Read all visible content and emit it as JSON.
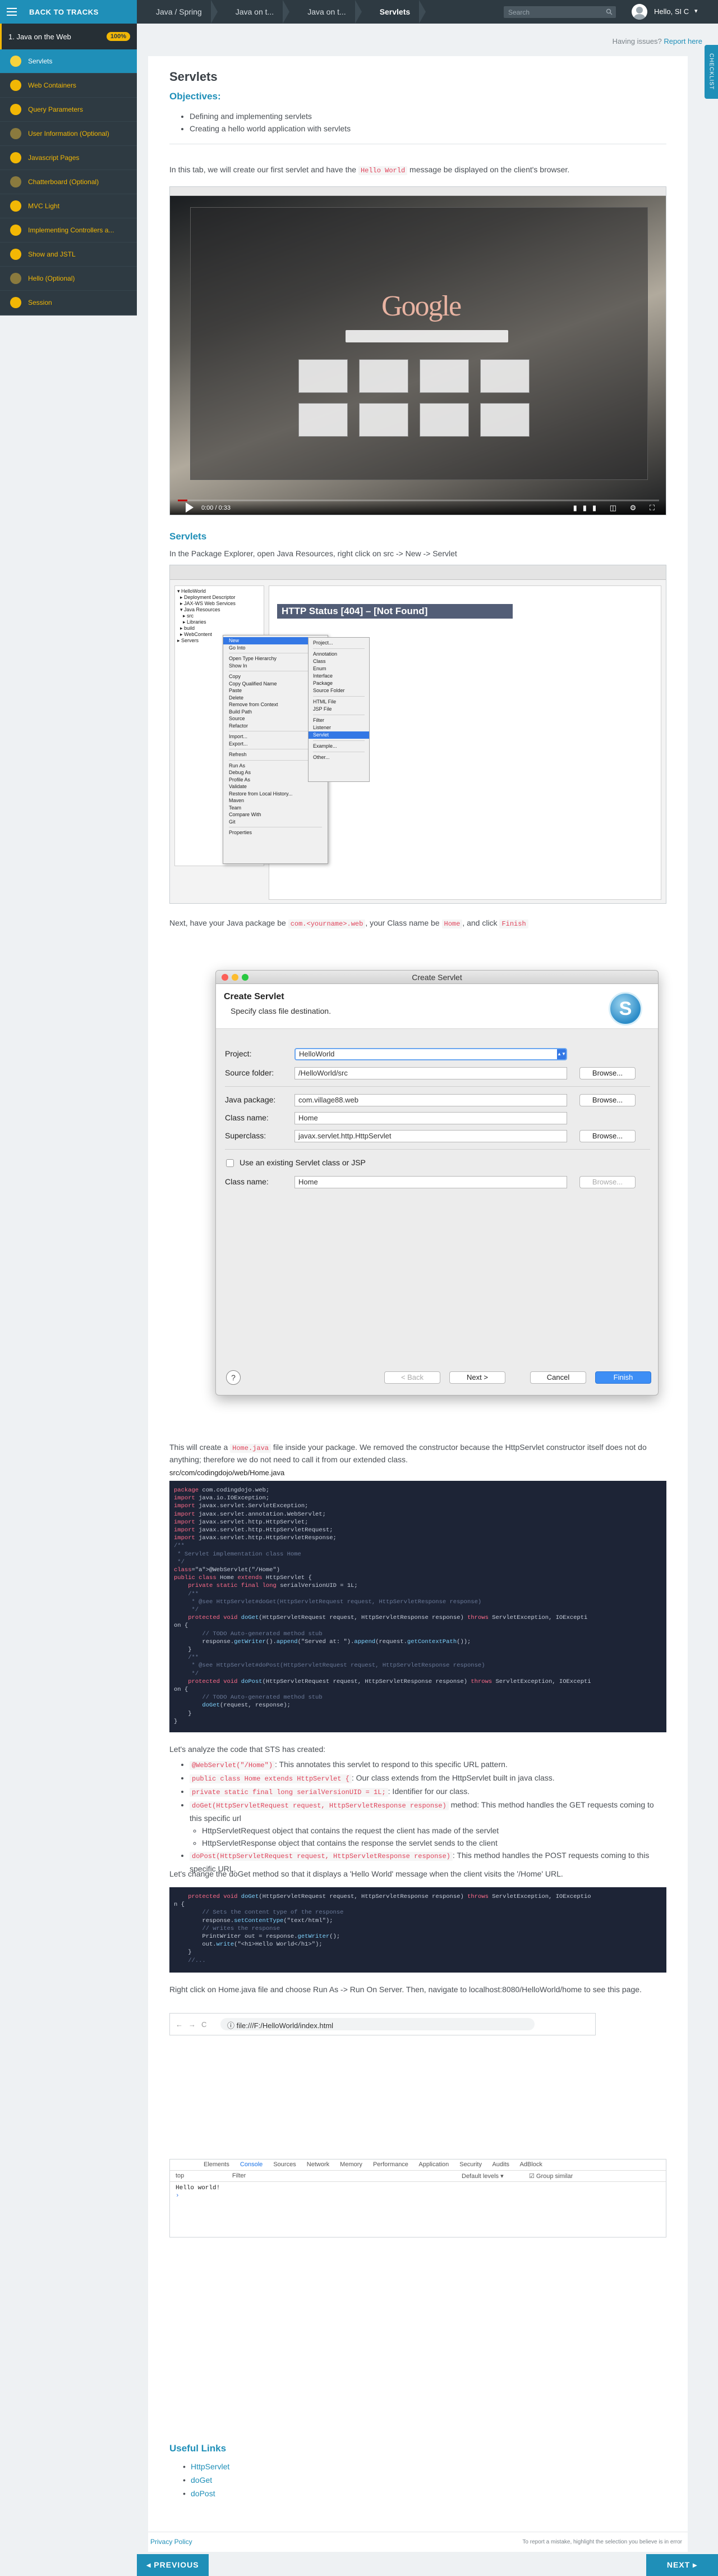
{
  "topbar": {
    "back_label": "BACK TO TRACKS",
    "breadcrumbs": [
      "Java / Spring",
      "Java on t...",
      "Java on t...",
      "Servlets"
    ],
    "search_placeholder": "Search",
    "user_name": "Hello, SI C",
    "user_caret": "▾"
  },
  "sidebar": {
    "header": "1. Java on the Web",
    "progress": "100%",
    "items": [
      {
        "label": "Servlets",
        "active": true
      },
      {
        "label": "Web Containers"
      },
      {
        "label": "Query Parameters"
      },
      {
        "label": "User Information (Optional)"
      },
      {
        "label": "Javascript Pages"
      },
      {
        "label": "Chatterboard (Optional)"
      },
      {
        "label": "MVC Light"
      },
      {
        "label": "Implementing Controllers a..."
      },
      {
        "label": "Show and JSTL"
      },
      {
        "label": "Hello (Optional)"
      },
      {
        "label": "Session"
      }
    ]
  },
  "help": {
    "text": "Having issues?",
    "link": "Report here"
  },
  "side_tab": "CHECKLIST",
  "article": {
    "title": "Servlets",
    "objectives_heading": "Objectives:",
    "objectives": [
      "Defining and implementing servlets",
      "Creating a hello world application with servlets"
    ],
    "intro_before": "In this tab, we will create our first servlet and have the",
    "intro_code": "Hello World",
    "intro_after": "message be displayed on the client's browser.",
    "section_servlets": "Servlets",
    "package_explorer": "In the Package Explorer, open Java Resources, right click on src -> New -> Servlet",
    "next_before": "Next, have your Java package be",
    "next_code1": "com.<yourname>.web",
    "next_mid": ", your Class name be",
    "next_code2": "Home",
    "next_and": ", and click",
    "next_code3": "Finish",
    "create_before": "This will create a",
    "create_code": "Home.java",
    "create_after": "file inside your package. We removed the constructor because the HttpServlet constructor itself does not do anything; therefore we do not need to call it from our extended class.",
    "file_path": "src/com/codingdojo/web/Home.java",
    "analyze": "Let's analyze the code that STS has created:",
    "analysis": [
      {
        "code": "@WebServlet(\"/Home\")",
        "text": ": This annotates this servlet to respond to this specific URL pattern."
      },
      {
        "code": "public class Home extends HttpServlet {",
        "text": ": Our class extends from the HttpServlet built in java class."
      },
      {
        "code": "private static final long serialVersionUID = 1L;",
        "text": ": Identifier for our class."
      },
      {
        "code": "doGet(HttpServletRequest request, HttpServletResponse response)",
        "text": " method: This method handles the GET requests coming to this specific url"
      },
      {
        "code": "doPost(HttpServletRequest request, HttpServletResponse response)",
        "text": ": This method handles the POST requests coming to this specific URL."
      }
    ],
    "sub_points": [
      "HttpServletRequest object that contains the request the client has made of the servlet",
      "HttpServletResponse object that contains the response the servlet sends to the client"
    ],
    "change_doget": "Let's change the doGet method so that it displays a 'Hello World' message when the client visits the '/Home' URL.",
    "run_on_server": "Right click on Home.java file and choose Run As -> Run On Server. Then, navigate to localhost:8080/HelloWorld/home to see this page.",
    "useful_links_heading": "Useful Links",
    "useful_links": [
      "HttpServlet",
      "doGet",
      "doPost"
    ]
  },
  "video": {
    "time": "0:00 / 0:33",
    "progress_fraction": 0.02
  },
  "eclipse": {
    "http_status": "HTTP Status [404] – [Not Found]",
    "context_menu": [
      "New",
      "Go Into",
      "",
      "Open Type Hierarchy",
      "Show In",
      "",
      "Copy",
      "Copy Qualified Name",
      "Paste",
      "Delete",
      "Remove from Context",
      "Build Path",
      "Source",
      "Refactor",
      "",
      "Import...",
      "Export...",
      "",
      "Refresh",
      "",
      "Run As",
      "Debug As",
      "Profile As",
      "Validate",
      "Restore from Local History...",
      "Maven",
      "Team",
      "Compare With",
      "Git",
      "",
      "Properties"
    ],
    "submenu": [
      "Project...",
      "",
      "Annotation",
      "Class",
      "Enum",
      "Interface",
      "Package",
      "Source Folder",
      "",
      "HTML File",
      "JSP File",
      "",
      "Filter",
      "Listener",
      "Servlet",
      "",
      "Example...",
      "",
      "Other..."
    ],
    "highlighted_menu": "New",
    "highlighted_sub": "Servlet"
  },
  "dialog": {
    "window_title": "Create Servlet",
    "heading": "Create Servlet",
    "subheading": "Specify class file destination.",
    "project_label": "Project:",
    "project_value": "HelloWorld",
    "source_folder_label": "Source folder:",
    "source_folder_value": "/HelloWorld/src",
    "java_package_label": "Java package:",
    "java_package_value": "com.village88.web",
    "class_name_label": "Class name:",
    "class_name_value": "Home",
    "superclass_label": "Superclass:",
    "superclass_value": "javax.servlet.http.HttpServlet",
    "use_existing_label": "Use an existing Servlet class or JSP",
    "class_name2_label": "Class name:",
    "class_name2_value": "Home",
    "browse": "Browse...",
    "back": "< Back",
    "next": "Next >",
    "cancel": "Cancel",
    "finish": "Finish"
  },
  "code1": [
    "package com.codingdojo.web;",
    "import java.io.IOException;",
    "import javax.servlet.ServletException;",
    "import javax.servlet.annotation.WebServlet;",
    "import javax.servlet.http.HttpServlet;",
    "import javax.servlet.http.HttpServletRequest;",
    "import javax.servlet.http.HttpServletResponse;",
    "/**",
    " * Servlet implementation class Home",
    " */",
    "@WebServlet(\"/Home\")",
    "public class Home extends HttpServlet {",
    "    private static final long serialVersionUID = 1L;",
    "    /**",
    "     * @see HttpServlet#doGet(HttpServletRequest request, HttpServletResponse response)",
    "     */",
    "    protected void doGet(HttpServletRequest request, HttpServletResponse response) throws ServletException, IOExcepti",
    "on {",
    "        // TODO Auto-generated method stub",
    "        response.getWriter().append(\"Served at: \").append(request.getContextPath());",
    "    }",
    "    /**",
    "     * @see HttpServlet#doPost(HttpServletRequest request, HttpServletResponse response)",
    "     */",
    "    protected void doPost(HttpServletRequest request, HttpServletResponse response) throws ServletException, IOExcepti",
    "on {",
    "        // TODO Auto-generated method stub",
    "        doGet(request, response);",
    "    }",
    "}"
  ],
  "code2": [
    "    protected void doGet(HttpServletRequest request, HttpServletResponse response) throws ServletException, IOExceptio",
    "n {",
    "        // Sets the content type of the response",
    "        response.setContentType(\"text/html\");",
    "        // writes the response",
    "        PrintWriter out = response.getWriter();",
    "        out.write(\"<h1>Hello World</h1>\");",
    "    }",
    "    //..."
  ],
  "browser": {
    "url": "file:///F:/HelloWorld/index.html"
  },
  "devtools": {
    "tabs": [
      "Elements",
      "Console",
      "Sources",
      "Network",
      "Memory",
      "Performance",
      "Application",
      "Security",
      "Audits",
      "AdBlock"
    ],
    "context": "top",
    "filter_placeholder": "Filter",
    "levels": "Default levels ▾",
    "group_similar": "Group similar",
    "output": "Hello world!"
  },
  "footer": {
    "privacy": "Privacy Policy",
    "note": "To report a mistake, highlight the selection you believe is in error",
    "prev": "◂ PREVIOUS",
    "next": "NEXT ▸"
  },
  "colors": {
    "accent": "#1f8fb8",
    "sidebar_bg": "#2e3a42",
    "highlight": "#f2b705",
    "code_bg": "#1d2436"
  }
}
